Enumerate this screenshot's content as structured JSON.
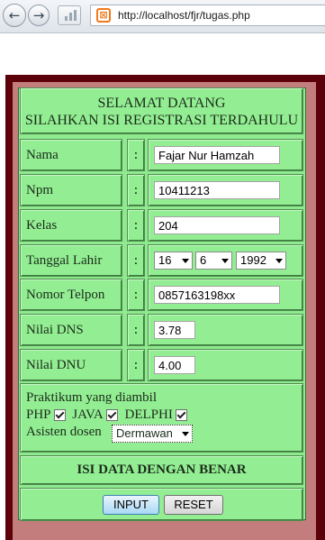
{
  "browser": {
    "url": "http://localhost/fjr/tugas.php",
    "back_icon": "back-arrow-icon",
    "forward_icon": "forward-arrow-icon"
  },
  "form": {
    "title_line1": "SELAMAT DATANG",
    "title_line2": "SILAHKAN ISI REGISTRASI TERDAHULU",
    "colon": ":",
    "fields": {
      "nama": {
        "label": "Nama",
        "value": "Fajar Nur Hamzah"
      },
      "npm": {
        "label": "Npm",
        "value": "10411213"
      },
      "kelas": {
        "label": "Kelas",
        "value": "204"
      },
      "tanggal_lahir": {
        "label": "Tanggal Lahir",
        "day": "16",
        "month": "6",
        "year": "1992"
      },
      "nomor_telpon": {
        "label": "Nomor Telpon",
        "value": "0857163198xx"
      },
      "nilai_dns": {
        "label": "Nilai DNS",
        "value": "3.78"
      },
      "nilai_dnu": {
        "label": "Nilai DNU",
        "value": "4.00"
      }
    },
    "praktikum": {
      "label": "Praktikum yang diambil",
      "options": [
        {
          "label": "PHP",
          "checked": true
        },
        {
          "label": "JAVA",
          "checked": true
        },
        {
          "label": "DELPHI",
          "checked": true
        }
      ],
      "asisten_label": "Asisten dosen",
      "asisten_value": "Dermawan"
    },
    "note": "ISI DATA DENGAN BENAR",
    "buttons": {
      "input": "INPUT",
      "reset": "RESET"
    }
  },
  "colors": {
    "frame": "#5c0009",
    "frame_inner": "#c47d7d",
    "form_bg": "#93ee93"
  }
}
